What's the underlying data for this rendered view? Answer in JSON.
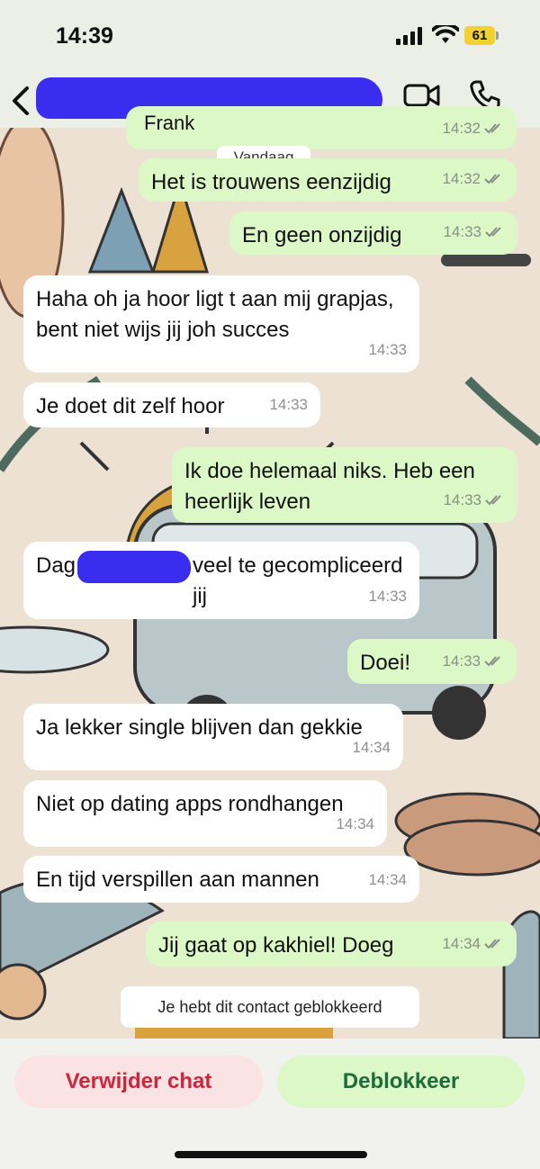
{
  "status_bar": {
    "time": "14:39",
    "battery": "61",
    "icons": [
      "signal-icon",
      "wifi-icon",
      "battery-icon"
    ]
  },
  "header": {
    "contact_name": "",
    "icons": [
      "back-icon",
      "video-call-icon",
      "phone-call-icon"
    ]
  },
  "chat": {
    "date_separator": "Vandaag",
    "messages": [
      {
        "direction": "out",
        "text": "Frank",
        "time": "14:32",
        "ticks": "double"
      },
      {
        "direction": "out",
        "text": "Het is trouwens eenzijdig",
        "time": "14:32",
        "ticks": "double"
      },
      {
        "direction": "out",
        "text": "En geen onzijdig",
        "time": "14:33",
        "ticks": "double"
      },
      {
        "direction": "in",
        "text": "Haha oh ja hoor ligt t aan mij grapjas, bent niet wijs jij joh succes",
        "time": "14:33"
      },
      {
        "direction": "in",
        "text": "Je doet dit zelf hoor",
        "time": "14:33"
      },
      {
        "direction": "out",
        "text": "Ik doe helemaal niks. Heb een heerlijk leven",
        "time": "14:33",
        "ticks": "double"
      },
      {
        "direction": "in",
        "text": "Dag",
        "text_after": "veel te gecompliceerd jij",
        "time": "14:33"
      },
      {
        "direction": "out",
        "text": "Doei!",
        "time": "14:33",
        "ticks": "double"
      },
      {
        "direction": "in",
        "text": "Ja lekker single blijven dan gekkie",
        "time": "14:34"
      },
      {
        "direction": "in",
        "text": "Niet op dating apps rondhangen",
        "time": "14:34"
      },
      {
        "direction": "in",
        "text": "En tijd verspillen aan mannen",
        "time": "14:34"
      },
      {
        "direction": "out",
        "text": "Jij gaat op kakhiel! Doeg",
        "time": "14:34",
        "ticks": "double"
      }
    ],
    "system_note": "Je hebt dit contact geblokkeerd"
  },
  "actions": {
    "delete_label": "Verwijder chat",
    "unblock_label": "Deblokkeer"
  },
  "colors": {
    "outgoing_bubble": "#dcf8c6",
    "incoming_bubble": "#ffffff",
    "delete_text": "#d0243a",
    "unblock_text": "#1e6b3c",
    "redaction": "#3a2df0"
  }
}
